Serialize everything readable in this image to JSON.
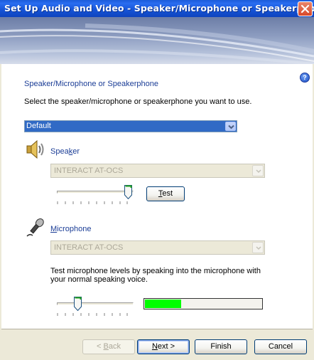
{
  "window": {
    "title": "Set Up Audio and Video - Speaker/Microphone or Speakerphone"
  },
  "content": {
    "heading": "Speaker/Microphone or Speakerphone",
    "instruction": "Select the speaker/microphone or speakerphone you want to use.",
    "device_select": {
      "value": "Default"
    },
    "speaker": {
      "label_pre": "Spea",
      "label_access": "k",
      "label_post": "er",
      "device": "INTERACT AT-OCS",
      "volume_fraction": 0.98,
      "test_button": {
        "access": "T",
        "rest": "est"
      }
    },
    "microphone": {
      "label_access": "M",
      "label_rest": "icrophone",
      "device": "INTERACT AT-OCS",
      "instruction": "Test microphone levels by speaking into the microphone with your normal speaking voice.",
      "volume_fraction": 0.25,
      "level_fraction": 0.31,
      "level_color": "#00ff00"
    }
  },
  "buttons": {
    "back": {
      "pre": "< ",
      "access": "B",
      "rest": "ack"
    },
    "next": {
      "access": "N",
      "rest": "ext >"
    },
    "finish": "Finish",
    "cancel": "Cancel"
  },
  "colors": {
    "title_bar": "#0f44bd",
    "link_text": "#1b3d96",
    "selection": "#316ac5",
    "dialog_face": "#ece9d8"
  },
  "icons": [
    "close-icon",
    "help-icon",
    "speaker-icon",
    "microphone-icon",
    "chevron-down-icon"
  ]
}
